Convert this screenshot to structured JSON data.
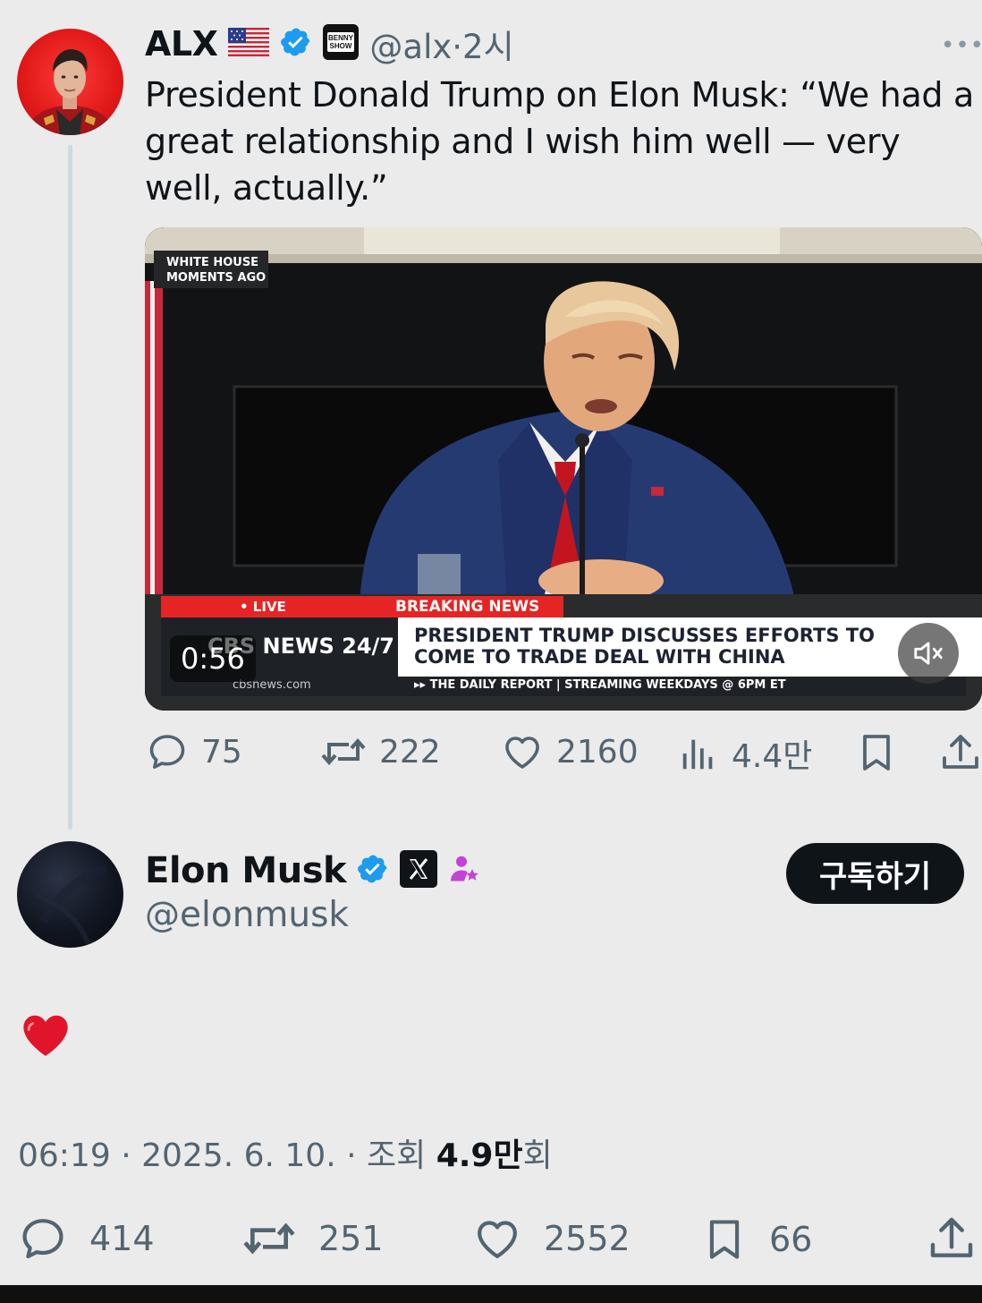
{
  "quoted_tweet": {
    "display_name": "ALX",
    "flag_icon": "us-flag-icon",
    "verified": true,
    "affiliate_badge": "BENNY SHOW",
    "handle": "@alx",
    "separator": "·",
    "time": "2시",
    "more_label": "•••",
    "text": "President Donald Trump on Elon Musk: “We had a great relationship and I wish him well — very well, actually.”",
    "video": {
      "location_tag_line1": "WHITE HOUSE",
      "location_tag_line2": "MOMENTS AGO",
      "live_label": "• LIVE",
      "breaking_label": "BREAKING NEWS",
      "network_label": "CBS NEWS 24/7",
      "network_site": "cbsnews.com",
      "headline_line1": "PRESIDENT TRUMP DISCUSSES EFFORTS TO",
      "headline_line2": "COME TO TRADE DEAL WITH CHINA",
      "ticker": "▸▸ THE DAILY REPORT | STREAMING WEEKDAYS @ 6PM ET",
      "duration": "0:56",
      "mute_icon": "muted-speaker-icon"
    },
    "actions": {
      "replies": "75",
      "reposts": "222",
      "likes": "2160",
      "views": "4.4만"
    }
  },
  "main_tweet": {
    "display_name": "Elon Musk",
    "verified": true,
    "affiliate_badge": "X",
    "handle": "@elonmusk",
    "subscribe_label": "구독하기",
    "content_emoji": "❤️",
    "time": "06:19",
    "date": "2025. 6. 10.",
    "views_prefix": "조회",
    "views_value": "4.9만",
    "views_suffix": "회",
    "actions": {
      "replies": "414",
      "reposts": "251",
      "likes": "2552",
      "bookmarks": "66"
    }
  },
  "colors": {
    "background": "#ebebeb",
    "verified_blue": "#1d9bf0",
    "text_primary": "#0f1419",
    "text_secondary": "#536471",
    "breaking_red": "#e52524",
    "subscribe_button": "#0f1419"
  }
}
